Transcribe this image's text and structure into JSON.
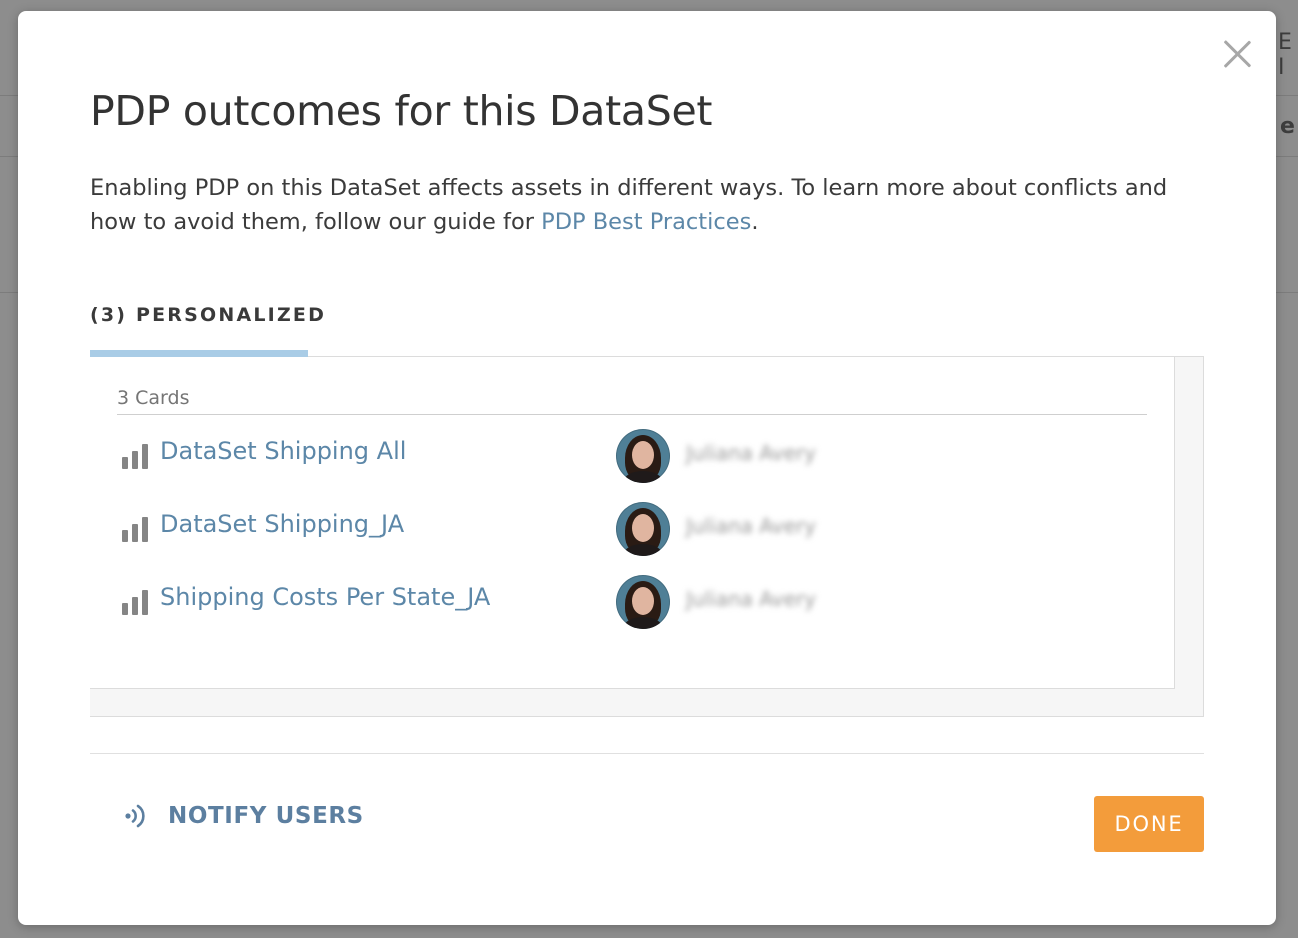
{
  "background": {
    "fragment_top": "E I",
    "fragment_mid": "e"
  },
  "modal": {
    "title": "PDP outcomes for this DataSet",
    "description_text": "Enabling PDP on this DataSet affects assets in different ways. To learn more about conflicts and how to avoid them, follow our guide for ",
    "description_link": "PDP Best Practices",
    "description_end": ".",
    "close_icon": "close-icon"
  },
  "tabs": [
    {
      "label": "(3) PERSONALIZED",
      "active": true
    }
  ],
  "section": {
    "heading": "3 Cards",
    "cards": [
      {
        "name": "DataSet Shipping All",
        "icon": "bar-chart-icon",
        "owner": "Juliana Avery"
      },
      {
        "name": "DataSet Shipping_JA",
        "icon": "bar-chart-icon",
        "owner": "Juliana Avery"
      },
      {
        "name": "Shipping Costs Per State_JA",
        "icon": "bar-chart-icon",
        "owner": "Juliana Avery"
      }
    ]
  },
  "footer": {
    "notify_label": "NOTIFY USERS",
    "notify_icon": "broadcast-icon",
    "done_label": "DONE"
  },
  "colors": {
    "link": "#5c87a8",
    "tab_accent": "#a9cce6",
    "done_button": "#f39c3b"
  }
}
